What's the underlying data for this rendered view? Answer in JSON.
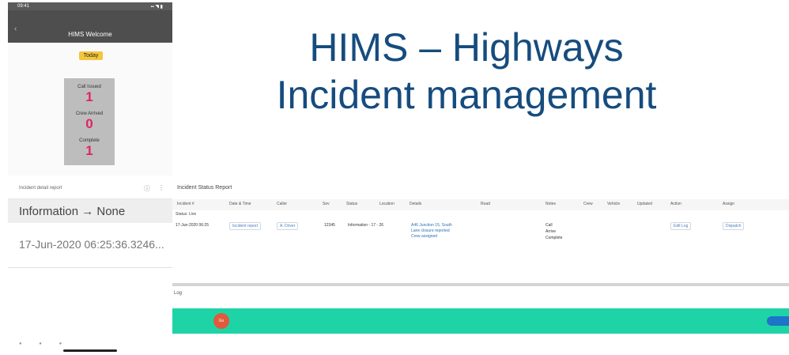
{
  "phone1": {
    "status_time": "09:41",
    "status_icons": "▪▪ ◥ ▮",
    "back_glyph": "‹",
    "nav_title": "HIMS Welcome",
    "today_label": "Today",
    "stats": [
      {
        "label": "Call Issued",
        "value": "1"
      },
      {
        "label": "Crew Arrived",
        "value": "0"
      },
      {
        "label": "Complete",
        "value": "1"
      }
    ]
  },
  "phone2": {
    "header_label": "Incident detail report",
    "info_line": "Information → None",
    "timestamp": "17-Jun-2020 06:25:36.3246..."
  },
  "title": {
    "line1": "HIMS – Highways",
    "line2": "Incident management"
  },
  "web": {
    "page_title": "Incident Status Report",
    "columns": [
      "Incident #",
      "Date & Time",
      "Caller",
      "Sev",
      "Status",
      "Location",
      "Details",
      "Road",
      "Notes",
      "Crew",
      "Vehicle",
      "Updated",
      "Action",
      "Assign"
    ],
    "group_label": "Status: Live",
    "row": {
      "datetime": "17-Jun-2020 06:25",
      "caller": "Incident report",
      "reporter": "A. Driver",
      "id": "12345",
      "status_text": "Information - 17 - 26",
      "location_1": "A46 Junction 15, South",
      "location_2": "Lane closure reported",
      "location_3": "Crew assigned",
      "crew_1": "Call",
      "crew_2": "Arrive",
      "crew_3": "Complete",
      "action_1": "Edit Log",
      "action_2": "Dispatch"
    },
    "lower_label": "Log",
    "fab_label": "Go"
  }
}
